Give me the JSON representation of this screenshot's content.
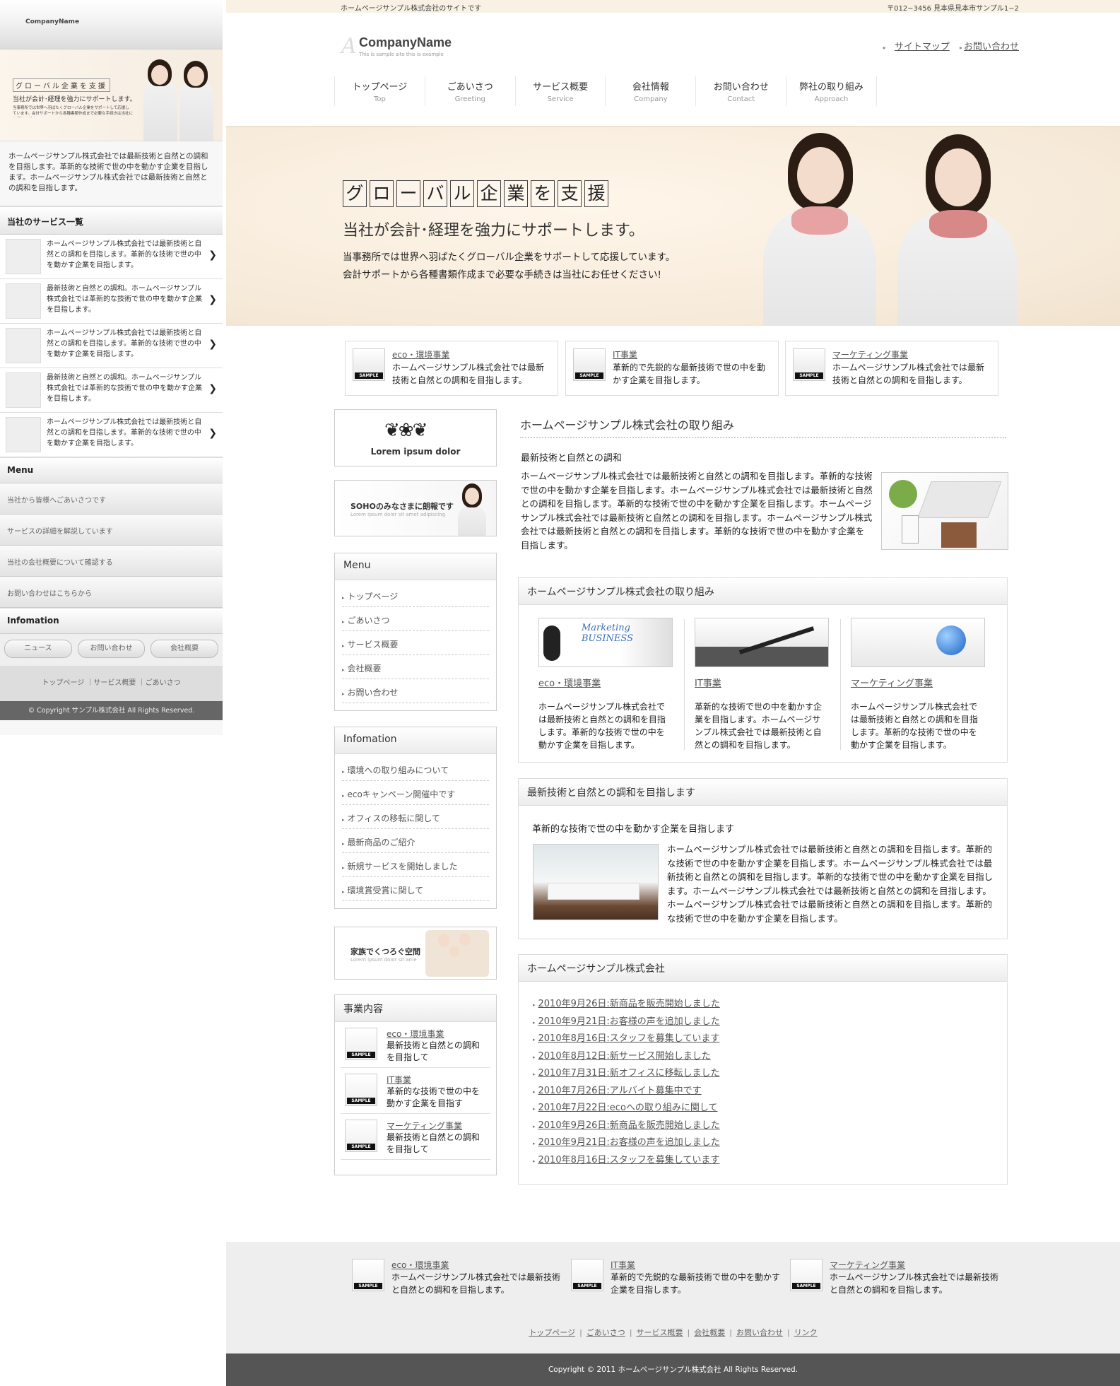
{
  "mobile": {
    "company": "CompanyName",
    "hero": {
      "line1": "グローバル企業を支援",
      "line2": "当社が会計･経理を強力にサポートします。",
      "line3": "当事務所では世界へ羽ばたくグローバル企業をサポートして応援しています。会計サポートから各種書類作成まで必要な手続きは当社にお任せください!"
    },
    "intro": "ホームページサンプル株式会社では最新技術と自然との調和を目指します。革新的な技術で世の中を動かす企業を目指します。ホームページサンプル株式会社では最新技術と自然との調和を目指します。",
    "services_title": "当社のサービス一覧",
    "services": [
      {
        "text": "ホームページサンプル株式会社では最新技術と自然との調和を目指します。革新的な技術で世の中を動かす企業を目指します。"
      },
      {
        "text": "最新技術と自然との調和。ホームページサンプル株式会社では革新的な技術で世の中を動かす企業を目指します。"
      },
      {
        "text": "ホームページサンプル株式会社では最新技術と自然との調和を目指します。革新的な技術で世の中を動かす企業を目指します。"
      },
      {
        "text": "最新技術と自然との調和。ホームページサンプル株式会社では革新的な技術で世の中を動かす企業を目指します。"
      },
      {
        "text": "ホームページサンプル株式会社では最新技術と自然との調和を目指します。革新的な技術で世の中を動かす企業を目指します。"
      }
    ],
    "menu_title": "Menu",
    "menu": [
      "当社から皆様へごあいさつです",
      "サービスの詳細を解説しています",
      "当社の会社概要について確認する",
      "お問い合わせはこちらから"
    ],
    "info_title": "Infomation",
    "buttons": [
      "ニュース",
      "お問い合わせ",
      "会社概要"
    ],
    "footer_links": "トップページ ｜サービス概要 ｜ごあいさつ",
    "copyright": "© Copyright サンプル株式会社 All Rights Reserved."
  },
  "top_bar": {
    "left": "ホームページサンプル株式会社のサイトです",
    "right": "〒012−3456 見本県見本市サンプル1−2"
  },
  "logo": {
    "name": "CompanyName",
    "sub": "This is sample site this is example"
  },
  "top_links": [
    "サイトマップ",
    "お問い合わせ"
  ],
  "gnav": [
    {
      "jp": "トップページ",
      "en": "Top"
    },
    {
      "jp": "ごあいさつ",
      "en": "Greeting"
    },
    {
      "jp": "サービス概要",
      "en": "Service"
    },
    {
      "jp": "会社情報",
      "en": "Company"
    },
    {
      "jp": "お問い合わせ",
      "en": "Contact"
    },
    {
      "jp": "弊社の取り組み",
      "en": "Approach"
    }
  ],
  "hero": {
    "chars": [
      "グ",
      "ロ",
      "ー",
      "バ",
      "ル",
      "企",
      "業",
      "を",
      "支",
      "援"
    ],
    "sub": "当社が会計･経理を強力にサポートします。",
    "p1": "当事務所では世界へ羽ばたくグローバル企業をサポートして応援しています。",
    "p2": "会計サポートから各種書類作成まで必要な手続きは当社にお任せください!"
  },
  "sample_label": "SAMPLE",
  "features": [
    {
      "title": "eco・環境事業",
      "text": "ホームページサンプル株式会社では最新技術と自然との調和を目指します。"
    },
    {
      "title": "IT事業",
      "text": "革新的で先鋭的な最新技術で世の中を動かす企業を目指します。"
    },
    {
      "title": "マーケティング事業",
      "text": "ホームページサンプル株式会社では最新技術と自然との調和を目指します。"
    }
  ],
  "sidebar": {
    "banner1": "Lorem ipsum dolor",
    "banner2": {
      "title": "SOHOのみなさまに朗報です",
      "sub": "Lorem ipsum dolor sit amet adipiscing"
    },
    "menu_title": "Menu",
    "menu": [
      "トップページ",
      "ごあいさつ",
      "サービス概要",
      "会社概要",
      "お問い合わせ"
    ],
    "info_title": "Infomation",
    "info": [
      "環境への取り組みについて",
      "ecoキャンペーン開催中です",
      "オフィスの移転に関して",
      "最新商品のご紹介",
      "新規サービスを開始しました",
      "環境賞受賞に関して"
    ],
    "banner3": {
      "title": "家族でくつろぐ空間",
      "sub": "Lorem ipsum dolor sit ame"
    },
    "biz_title": "事業内容",
    "biz": [
      {
        "title": "eco・環境事業",
        "text": "最新技術と自然との調和を目指して"
      },
      {
        "title": "IT事業",
        "text": "革新的な技術で世の中を動かす企業を目指す"
      },
      {
        "title": "マーケティング事業",
        "text": "最新技術と自然との調和を目指して"
      }
    ]
  },
  "main": {
    "title": "ホームページサンプル株式会社の取り組み",
    "subtitle": "最新技術と自然との調和",
    "body": "ホームページサンプル株式会社では最新技術と自然との調和を目指します。革新的な技術で世の中を動かす企業を目指します。ホームページサンプル株式会社では最新技術と自然との調和を目指します。革新的な技術で世の中を動かす企業を目指します。ホームページサンプル株式会社では最新技術と自然との調和を目指します。ホームページサンプル株式会社では最新技術と自然との調和を目指します。革新的な技術で世の中を動かす企業を目指します。",
    "panel1": {
      "title": "ホームページサンプル株式会社の取り組み",
      "cols": [
        {
          "title": "eco・環境事業",
          "text": "ホームページサンプル株式会社では最新技術と自然との調和を目指します。革新的な技術で世の中を動かす企業を目指します。",
          "img_text": "Marketing BUSINESS"
        },
        {
          "title": "IT事業",
          "text": "革新的な技術で世の中を動かす企業を目指します。ホームページサンプル株式会社では最新技術と自然との調和を目指します。"
        },
        {
          "title": "マーケティング事業",
          "text": "ホームページサンプル株式会社では最新技術と自然との調和を目指します。革新的な技術で世の中を動かす企業を目指します。"
        }
      ]
    },
    "panel2": {
      "title": "最新技術と自然との調和を目指します",
      "subtitle": "革新的な技術で世の中を動かす企業を目指します",
      "text": "ホームページサンプル株式会社では最新技術と自然との調和を目指します。革新的な技術で世の中を動かす企業を目指します。ホームページサンプル株式会社では最新技術と自然との調和を目指します。革新的な技術で世の中を動かす企業を目指します。ホームページサンプル株式会社では最新技術と自然との調和を目指します。ホームページサンプル株式会社では最新技術と自然との調和を目指します。革新的な技術で世の中を動かす企業を目指します。"
    },
    "panel3": {
      "title": "ホームページサンプル株式会社",
      "news": [
        "2010年9月26日:新商品を販売開始しました",
        "2010年9月21日:お客様の声を追加しました",
        "2010年8月16日:スタッフを募集しています",
        "2010年8月12日:新サービス開始しました",
        "2010年7月31日:新オフィスに移転しました",
        "2010年7月26日:アルバイト募集中です",
        "2010年7月22日:ecoへの取り組みに関して",
        "2010年9月26日:新商品を販売開始しました",
        "2010年9月21日:お客様の声を追加しました",
        "2010年8月16日:スタッフを募集しています"
      ]
    }
  },
  "footer": {
    "items": [
      {
        "title": "eco・環境事業",
        "text": "ホームページサンプル株式会社では最新技術と自然との調和を目指します。"
      },
      {
        "title": "IT事業",
        "text": "革新的で先鋭的な最新技術で世の中を動かす企業を目指します。"
      },
      {
        "title": "マーケティング事業",
        "text": "ホームページサンプル株式会社では最新技術と自然との調和を目指します。"
      }
    ],
    "nav": [
      "トップページ",
      "ごあいさつ",
      "サービス概要",
      "会社概要",
      "お問い合わせ",
      "リンク"
    ],
    "copyright": "Copyright © 2011 ホームページサンプル株式会社 All Rights Reserved."
  }
}
